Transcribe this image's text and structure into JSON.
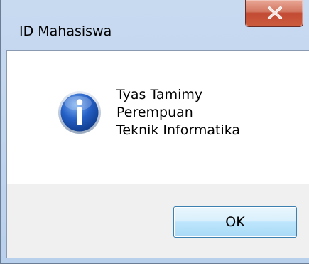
{
  "window": {
    "title": "ID Mahasiswa"
  },
  "icons": {
    "close": "close-icon",
    "info": "information-icon"
  },
  "message": {
    "lines": [
      "Tyas Tamimy",
      "Perempuan",
      "Teknik Informatika"
    ]
  },
  "buttons": {
    "ok_label": "OK"
  },
  "colors": {
    "close_button": "#c9543a",
    "info_icon": "#1b56b8",
    "ok_button_border": "#3c7fb1"
  }
}
